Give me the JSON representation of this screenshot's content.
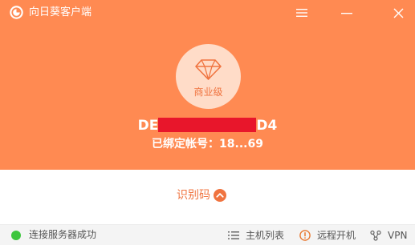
{
  "app": {
    "title": "向日葵客户端"
  },
  "window_controls": {
    "menu_icon": "hamburger-icon",
    "minimize_icon": "minimize-icon",
    "close_icon": "close-icon"
  },
  "license": {
    "icon": "diamond-icon",
    "label": "商业级"
  },
  "device": {
    "id_prefix": "DE",
    "id_suffix": "D4"
  },
  "account": {
    "text": "已绑定帐号：18...69"
  },
  "code_toggle": {
    "label": "识别码",
    "icon": "chevron-up-icon"
  },
  "status": {
    "text": "连接服务器成功",
    "color": "#3ec63e"
  },
  "statusbar": {
    "host_list_label": "主机列表",
    "remote_boot_label": "远程开机",
    "vpn_label": "VPN"
  },
  "colors": {
    "brand_orange": "#ff8a52",
    "accent_text": "#f07440",
    "redaction": "#e8162b"
  }
}
